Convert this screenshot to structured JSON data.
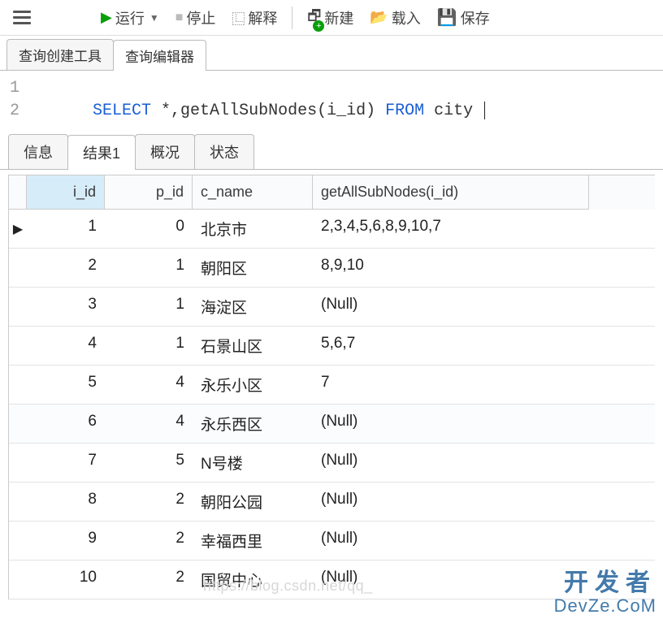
{
  "toolbar": {
    "run_label": "运行",
    "stop_label": "停止",
    "explain_label": "解释",
    "new_label": "新建",
    "load_label": "载入",
    "save_label": "保存"
  },
  "top_tabs": {
    "builder": "查询创建工具",
    "editor": "查询编辑器"
  },
  "editor": {
    "lines": [
      "1",
      "2"
    ],
    "sql_select": "SELECT",
    "sql_mid": " *,getAllSubNodes(i_id) ",
    "sql_from": "FROM",
    "sql_table": " city "
  },
  "result_tabs": {
    "info": "信息",
    "result1": "结果1",
    "overview": "概况",
    "status": "状态"
  },
  "columns": {
    "c1": "i_id",
    "c2": "p_id",
    "c3": "c_name",
    "c4": "getAllSubNodes(i_id)"
  },
  "rows": [
    {
      "i_id": "1",
      "p_id": "0",
      "c_name": "北京市",
      "sub": "2,3,4,5,6,8,9,10,7",
      "current": true
    },
    {
      "i_id": "2",
      "p_id": "1",
      "c_name": "朝阳区",
      "sub": "8,9,10"
    },
    {
      "i_id": "3",
      "p_id": "1",
      "c_name": "海淀区",
      "sub": "(Null)",
      "null": true
    },
    {
      "i_id": "4",
      "p_id": "1",
      "c_name": "石景山区",
      "sub": "5,6,7"
    },
    {
      "i_id": "5",
      "p_id": "4",
      "c_name": "永乐小区",
      "sub": "7"
    },
    {
      "i_id": "6",
      "p_id": "4",
      "c_name": "永乐西区",
      "sub": "(Null)",
      "null": true,
      "alt": true
    },
    {
      "i_id": "7",
      "p_id": "5",
      "c_name": "N号楼",
      "sub": "(Null)",
      "null": true
    },
    {
      "i_id": "8",
      "p_id": "2",
      "c_name": "朝阳公园",
      "sub": "(Null)",
      "null": true
    },
    {
      "i_id": "9",
      "p_id": "2",
      "c_name": "幸福西里",
      "sub": "(Null)",
      "null": true
    },
    {
      "i_id": "10",
      "p_id": "2",
      "c_name": "国贸中心",
      "sub": "(Null)",
      "null": true
    }
  ],
  "watermark": {
    "line1": "开发者",
    "line2": "DevZe.CoM",
    "faint": "https://blog.csdn.net/qq_"
  }
}
